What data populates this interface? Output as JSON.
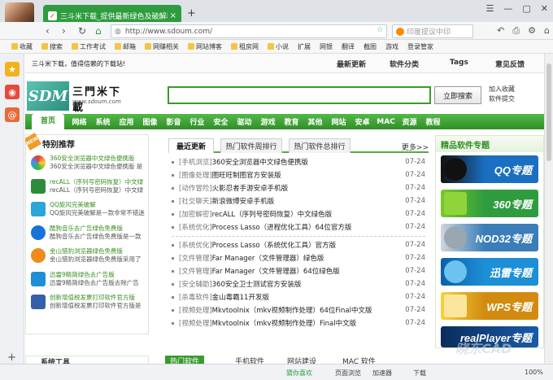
{
  "browser": {
    "tab_title": "三斗米下载_提供最新绿色及破解和手机",
    "tab_close": "×",
    "new_tab": "+",
    "window_controls": [
      "☰",
      "—",
      "▢",
      "✕"
    ],
    "address": "http://www.sdoum.com/",
    "search_placeholder": "印度提议中印",
    "nav": {
      "back": "‹",
      "forward": "›",
      "reload": "↻",
      "home": "⌂"
    },
    "right_tools": [
      "↶",
      "⎙",
      "⚙",
      "⌂"
    ]
  },
  "favorites": {
    "items": [
      "收藏",
      "搜索",
      "工作考试",
      "邮箱",
      "网赚相关",
      "网站博客",
      "租房网",
      "小说",
      "扩展",
      "网银",
      "翻译",
      "截图",
      "游戏",
      "登录管家"
    ]
  },
  "sidebar": {
    "plus": "+"
  },
  "site": {
    "slogan": "三斗米下载，值得信赖的下载站!",
    "top_links": [
      "最新更新",
      "软件分类",
      "Tags",
      "意见反馈"
    ],
    "logo_mark": "SDM",
    "logo_cn": "三門米下載",
    "logo_url": "www.sdoum.com",
    "search_button": "立即搜索",
    "add_fav": "加入收藏",
    "submit": "软件提交",
    "nav": [
      "首页",
      "网络",
      "系统",
      "应用",
      "图像",
      "影音",
      "行业",
      "安全",
      "驱动",
      "游戏",
      "教育",
      "其他",
      "网站",
      "安卓",
      "MAC",
      "资源",
      "教程"
    ]
  },
  "featured": {
    "title": "特别推荐",
    "badge": "NEW",
    "items": [
      {
        "a": "360安全浏览器中文绿色便携版",
        "b": "360安全浏览器中文绿色便携版 是"
      },
      {
        "a": "recALL（序列号密码恢复）中文绿",
        "b": "recALL（序列号密码恢复）中文绿"
      },
      {
        "a": "QQ旋风完美破解",
        "b": "QQ旋风完美破解是一款非常不错迷"
      },
      {
        "a": "酷狗音乐去广告绿色免费版",
        "b": "酷狗音乐去广告绿色免费版是一款"
      },
      {
        "a": "金山猎豹浏览器绿色免费版",
        "b": "金山猎豹浏览器绿色免费版采用了"
      },
      {
        "a": "迅雷9精简绿色去广告版",
        "b": "迅雷9精简绿色去广告版去除广告"
      },
      {
        "a": "创新增值税发票打印软件官方版",
        "b": "创新增值税发票打印软件官方版是"
      }
    ]
  },
  "updates": {
    "tabs": [
      "最近更新",
      "热门软件周排行",
      "热门软件总排行"
    ],
    "more": "更多>>",
    "list": [
      {
        "cat": "[手机浏览]",
        "title": "360安全浏览器中文绿色便携版",
        "date": "07-24"
      },
      {
        "cat": "[图像处理]",
        "title": "图旺旺制图官方安装版",
        "date": "07-24"
      },
      {
        "cat": "[动作冒险]",
        "title": "火影忍者手游安卓手机版",
        "date": "07-24"
      },
      {
        "cat": "[社交聊天]",
        "title": "新浪微博安卓手机版",
        "date": "07-24"
      },
      {
        "cat": "[加密解密]",
        "title": "recALL（序列号密码恢复）中文绿色版",
        "date": "07-24"
      },
      {
        "cat": "[系统优化]",
        "title": "Process Lasso（进程优化工具）64位官方版",
        "date": "07-24"
      },
      {
        "cat": "[系统优化]",
        "title": "Process Lasso（系统优化工具）官方版",
        "date": "07-24"
      },
      {
        "cat": "[文件管理]",
        "title": "Far Manager（文件管理器）绿色版",
        "date": "07-24"
      },
      {
        "cat": "[文件管理]",
        "title": "Far Manager（文件管理器）64位绿色版",
        "date": "07-24"
      },
      {
        "cat": "[安全辅助]",
        "title": "360安全卫士测试官方安装版",
        "date": "07-24"
      },
      {
        "cat": "[杀毒软件]",
        "title": "金山毒霸11开发版",
        "date": "07-24"
      },
      {
        "cat": "[视频处理]",
        "title": "Mkvtoolnix（mkv视频制作处理）64位Final中文版",
        "date": "07-24"
      },
      {
        "cat": "[视频处理]",
        "title": "Mkvtoolnix（mkv视频制作处理）Final中文版",
        "date": "07-24"
      }
    ]
  },
  "topics": {
    "title": "精品软件专题",
    "banners": [
      {
        "label": "QQ专题",
        "color": "#1a6fc0"
      },
      {
        "label": "360专题",
        "color": "#2e9c3e"
      },
      {
        "label": "NOD32专题",
        "color": "#3a7db8"
      },
      {
        "label": "迅雷专题",
        "color": "#1c8fd6"
      },
      {
        "label": "WPS专题",
        "color": "#d28b10"
      },
      {
        "label": "realPlayer专题",
        "color": "#1a5ca8"
      }
    ]
  },
  "bottom": {
    "left_title": "系统工具",
    "tabs": [
      "热门软件",
      "手机软件",
      "网站建设",
      "MAC 软件"
    ]
  },
  "status": {
    "items": [
      "猜你喜欢",
      "页面浏览",
      "加速器",
      "下载",
      "100%"
    ]
  },
  "watermark": "晓东CAD"
}
